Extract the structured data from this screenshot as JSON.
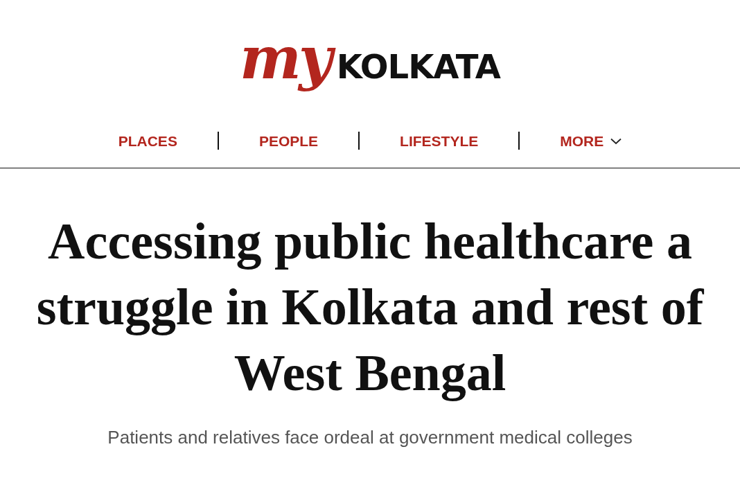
{
  "logo": {
    "first": "my",
    "second": "KOLKATA"
  },
  "nav": [
    {
      "label": "PLACES",
      "kind": "link"
    },
    {
      "label": "PEOPLE",
      "kind": "link"
    },
    {
      "label": "LIFESTYLE",
      "kind": "link"
    },
    {
      "label": "MORE",
      "kind": "dropdown"
    }
  ],
  "headline": "Accessing public healthcare a struggle in Kolkata and rest of West Bengal",
  "subheadline": "Patients and relatives face ordeal at government medical colleges"
}
